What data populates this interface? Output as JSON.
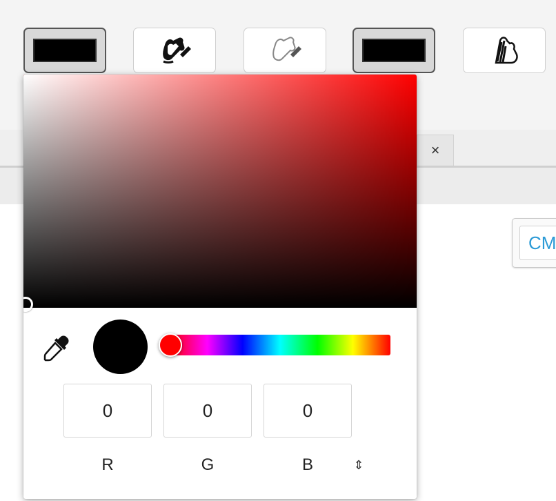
{
  "toolbar": {
    "buttons": [
      {
        "name": "foreground-color-swatch",
        "icon": "black-swatch",
        "color": "#000000"
      },
      {
        "name": "paint-bucket-fill",
        "icon": "paint-bucket-icon"
      },
      {
        "name": "paint-bucket-light",
        "icon": "paint-bucket-light-icon"
      },
      {
        "name": "background-color-swatch",
        "icon": "black-swatch",
        "color": "#000000"
      },
      {
        "name": "striped-fill",
        "icon": "striped-fill-icon"
      }
    ]
  },
  "background": {
    "close_tab_glyph": "×",
    "cmyk_label": "CM"
  },
  "picker": {
    "hue_color": "#ff0000",
    "selected_color": "#000000",
    "channels": [
      {
        "label": "R",
        "value": "0"
      },
      {
        "label": "G",
        "value": "0"
      },
      {
        "label": "B",
        "value": "0"
      }
    ],
    "mode_toggle_glyph": "⇕"
  }
}
